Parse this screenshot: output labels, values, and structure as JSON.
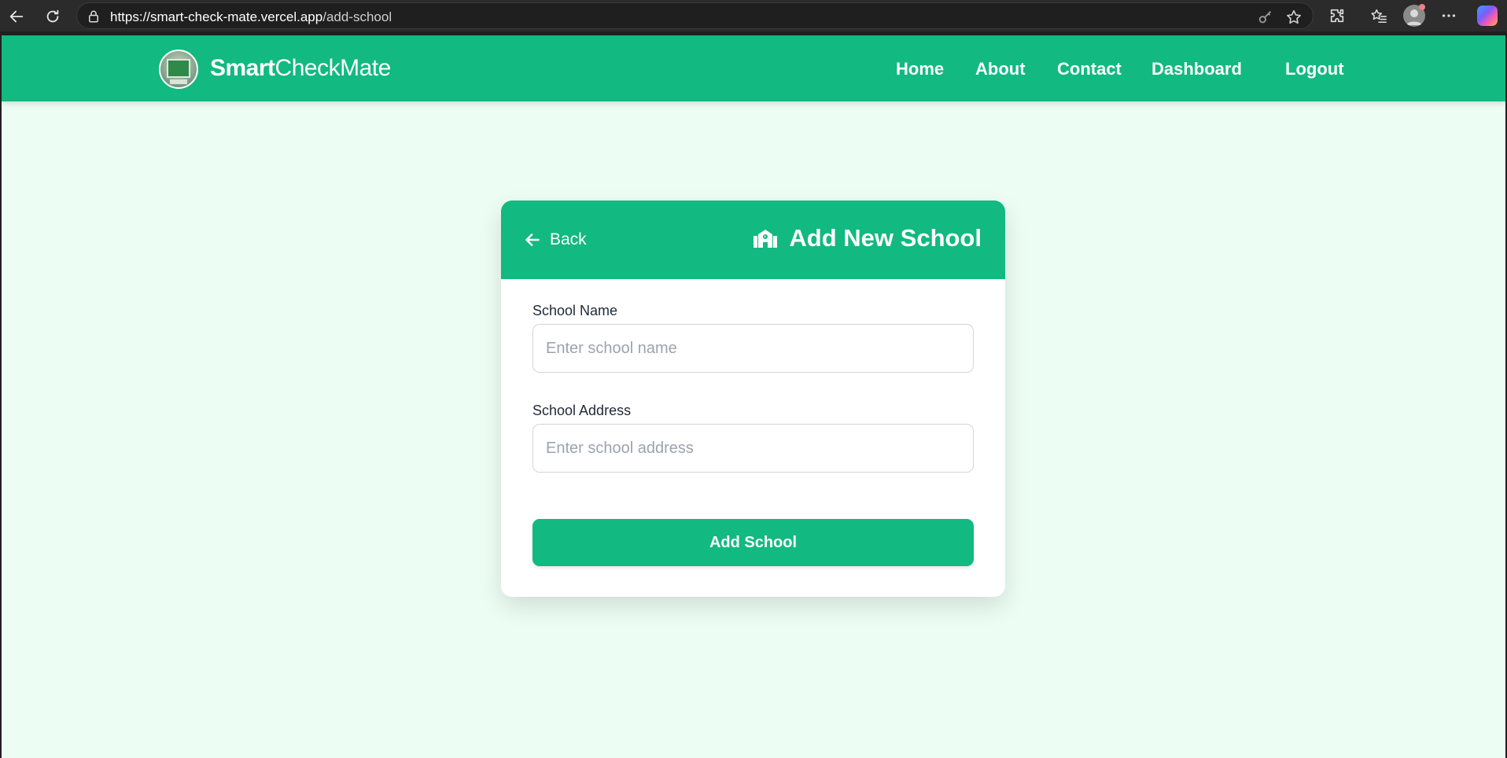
{
  "browser": {
    "url_host": "https://smart-check-mate.vercel.app",
    "url_path": "/add-school"
  },
  "site": {
    "brand_bold": "Smart",
    "brand_light": "CheckMate",
    "nav": [
      {
        "label": "Home"
      },
      {
        "label": "About"
      },
      {
        "label": "Contact"
      },
      {
        "label": "Dashboard"
      },
      {
        "label": "Logout"
      }
    ]
  },
  "card": {
    "back_label": "Back",
    "title": "Add New School",
    "fields": [
      {
        "label": "School Name",
        "placeholder": "Enter school name",
        "value": ""
      },
      {
        "label": "School Address",
        "placeholder": "Enter school address",
        "value": ""
      }
    ],
    "submit_label": "Add School"
  },
  "colors": {
    "primary": "#12b981",
    "page_bg": "#ecfdf4",
    "card_bg": "#ffffff"
  }
}
